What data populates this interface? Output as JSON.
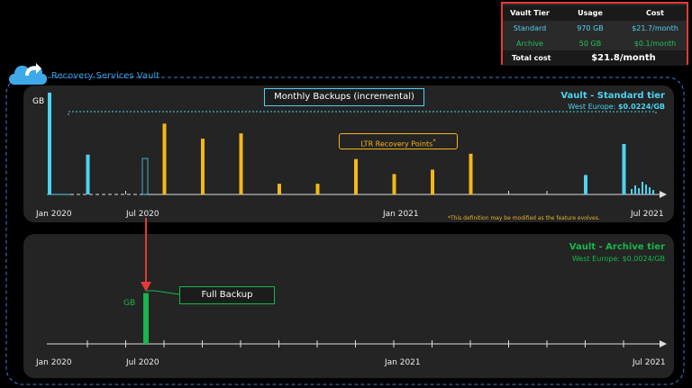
{
  "cost_table": {
    "headers": [
      "Vault Tier",
      "Usage",
      "Cost"
    ],
    "rows": [
      {
        "tier": "Standard",
        "usage": "970 GB",
        "cost": "$21.7/month"
      },
      {
        "tier": "Archive",
        "usage": "50 GB",
        "cost": "$0.1/month"
      }
    ],
    "total_label": "Total cost",
    "total_value": "$21.8/month"
  },
  "vault_label": "Recovery Services Vault",
  "standard": {
    "title": "Vault - Standard tier",
    "region_prefix": "West Europe: ",
    "price": "$0.0224/GB",
    "y_unit": "GB",
    "monthly_label": "Monthly Backups (incremental)",
    "ltr_label": "LTR Recovery Points",
    "ltr_mark": "*",
    "footnote": "*This definition may be modified as the feature evolves.",
    "axis_labels": [
      "Jan 2020",
      "Jul 2020",
      "Jan 2021",
      "Jul 2021"
    ]
  },
  "archive": {
    "title": "Vault - Archive tier",
    "region": "West Europe: $0.0024/GB",
    "y_unit": "GB",
    "full_label": "Full Backup",
    "axis_labels": [
      "Jan 2020",
      "Jul 2020",
      "Jan 2021",
      "Jul 2021"
    ]
  },
  "colors": {
    "standard": "#4dd3f0",
    "ltr": "#f5b719",
    "archive": "#16b74a",
    "arrow": "#e53935",
    "cost_border": "#e53935"
  },
  "chart_data": {
    "type": "bar",
    "series": [
      {
        "name": "Monthly Backups (incremental)",
        "color": "#4dd3f0",
        "values": [
          115,
          45,
          0,
          0,
          0,
          0,
          0,
          0,
          0,
          0,
          0,
          0,
          0,
          0,
          22,
          57
        ]
      },
      {
        "name": "LTR Recovery Points",
        "color": "#f5b719",
        "values": [
          0,
          0,
          0,
          80,
          63,
          69,
          12,
          12,
          40,
          23,
          28,
          46,
          0,
          0,
          0,
          0
        ]
      }
    ],
    "archive_full_backup_relative_height": 0.47
  }
}
